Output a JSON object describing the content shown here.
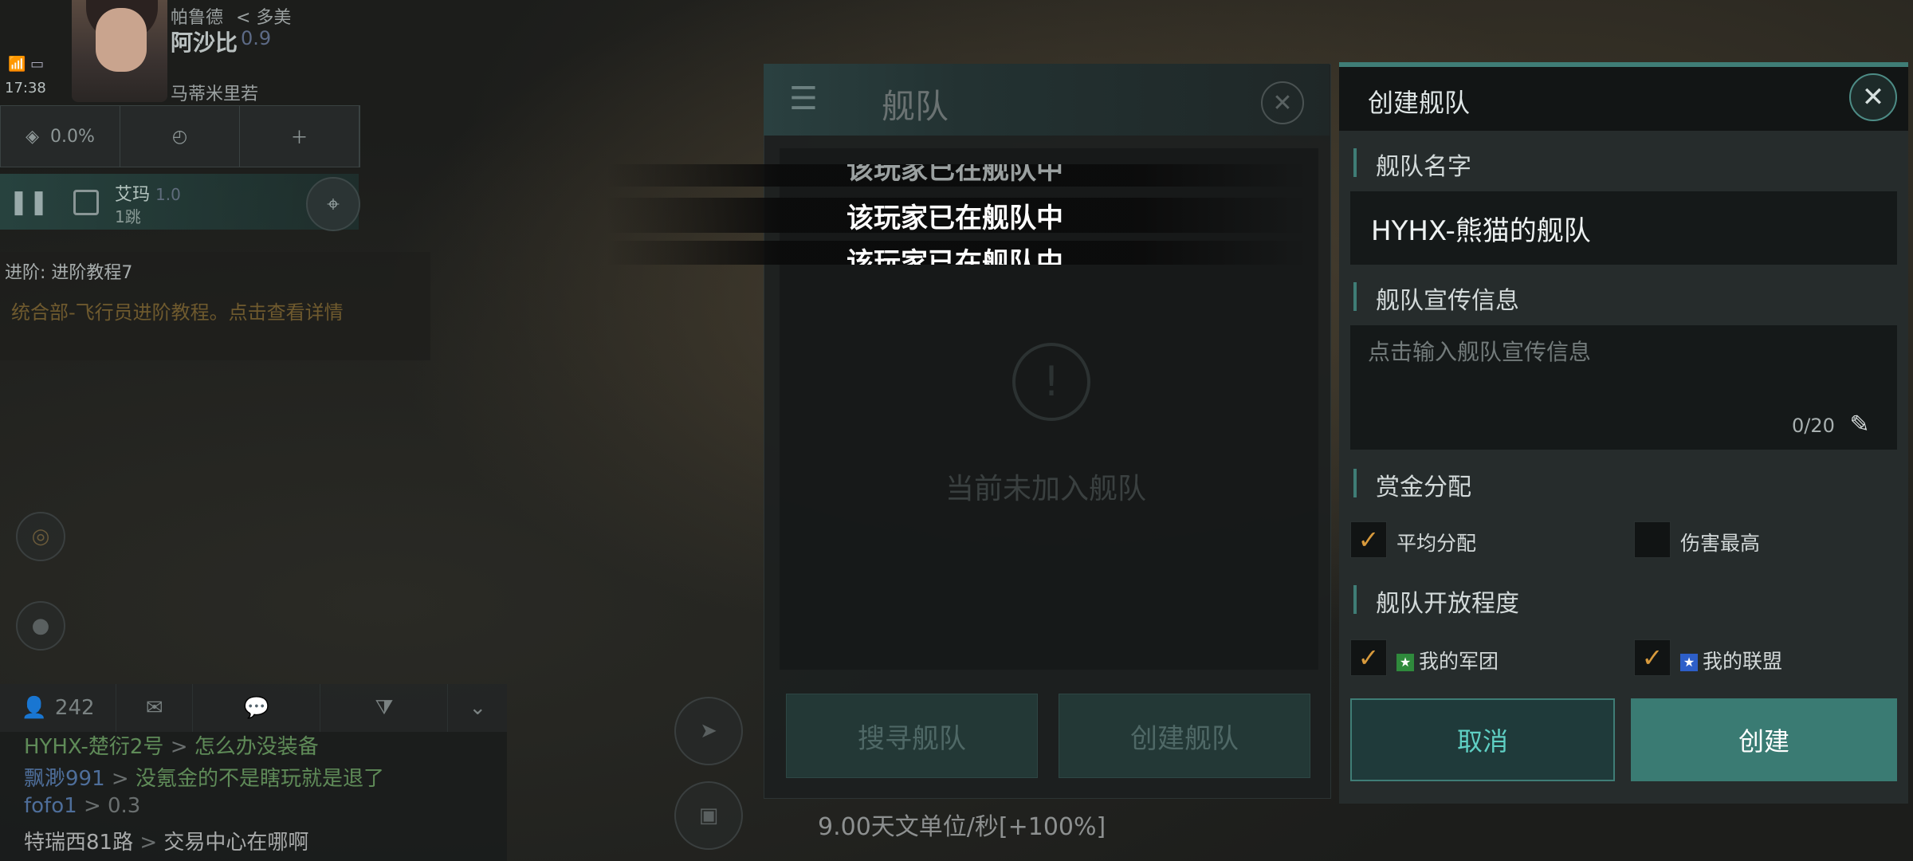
{
  "hud": {
    "location_top": "帕鲁德",
    "location_back": "< 多美",
    "system_name": "阿沙比",
    "security": "0.9",
    "station": "马蒂米里若",
    "time": "17:38",
    "cargo_pct": "0.0%",
    "nav_target": "艾玛",
    "nav_target_sec": "1.0",
    "nav_jumps": "1跳",
    "task_title": "进阶: 进阶教程7",
    "task_desc": "统合部-飞行员进阶教程。点击查看详情"
  },
  "chat": {
    "online_count": "242",
    "lines": [
      {
        "name": "HYHX-楚衍2号",
        "arrow": ">",
        "msg": "怎么办没装备"
      },
      {
        "name": "飘渺991",
        "arrow": ">",
        "msg": "没氪金的不是瞎玩就是退了"
      },
      {
        "name": "fofo1",
        "arrow": ">",
        "msg": "0.3"
      },
      {
        "name": "特瑞西81路",
        "arrow": ">",
        "msg": "交易中心在哪啊"
      }
    ]
  },
  "fleet_panel": {
    "title": "舰队",
    "empty_text": "当前未加入舰队",
    "search_btn": "搜寻舰队",
    "create_btn": "创建舰队",
    "speed": "9.00天文单位/秒[+100%]"
  },
  "toasts": [
    "该玩家已在舰队中",
    "该玩家已在舰队中",
    "该玩家已在舰队中"
  ],
  "create_panel": {
    "title": "创建舰队",
    "name_label": "舰队名字",
    "name_value": "HYHX-熊猫的舰队",
    "desc_label": "舰队宣传信息",
    "desc_placeholder": "点击输入舰队宣传信息",
    "desc_count": "0/20",
    "bounty_label": "赏金分配",
    "bounty_opt1": "平均分配",
    "bounty_opt2": "伤害最高",
    "open_label": "舰队开放程度",
    "open_opt1": "我的军团",
    "open_opt2": "我的联盟",
    "cancel_btn": "取消",
    "create_btn": "创建"
  },
  "colors": {
    "accent": "#3f7d76",
    "check": "#d89a3c",
    "cancel_text": "#5fd0c4"
  }
}
